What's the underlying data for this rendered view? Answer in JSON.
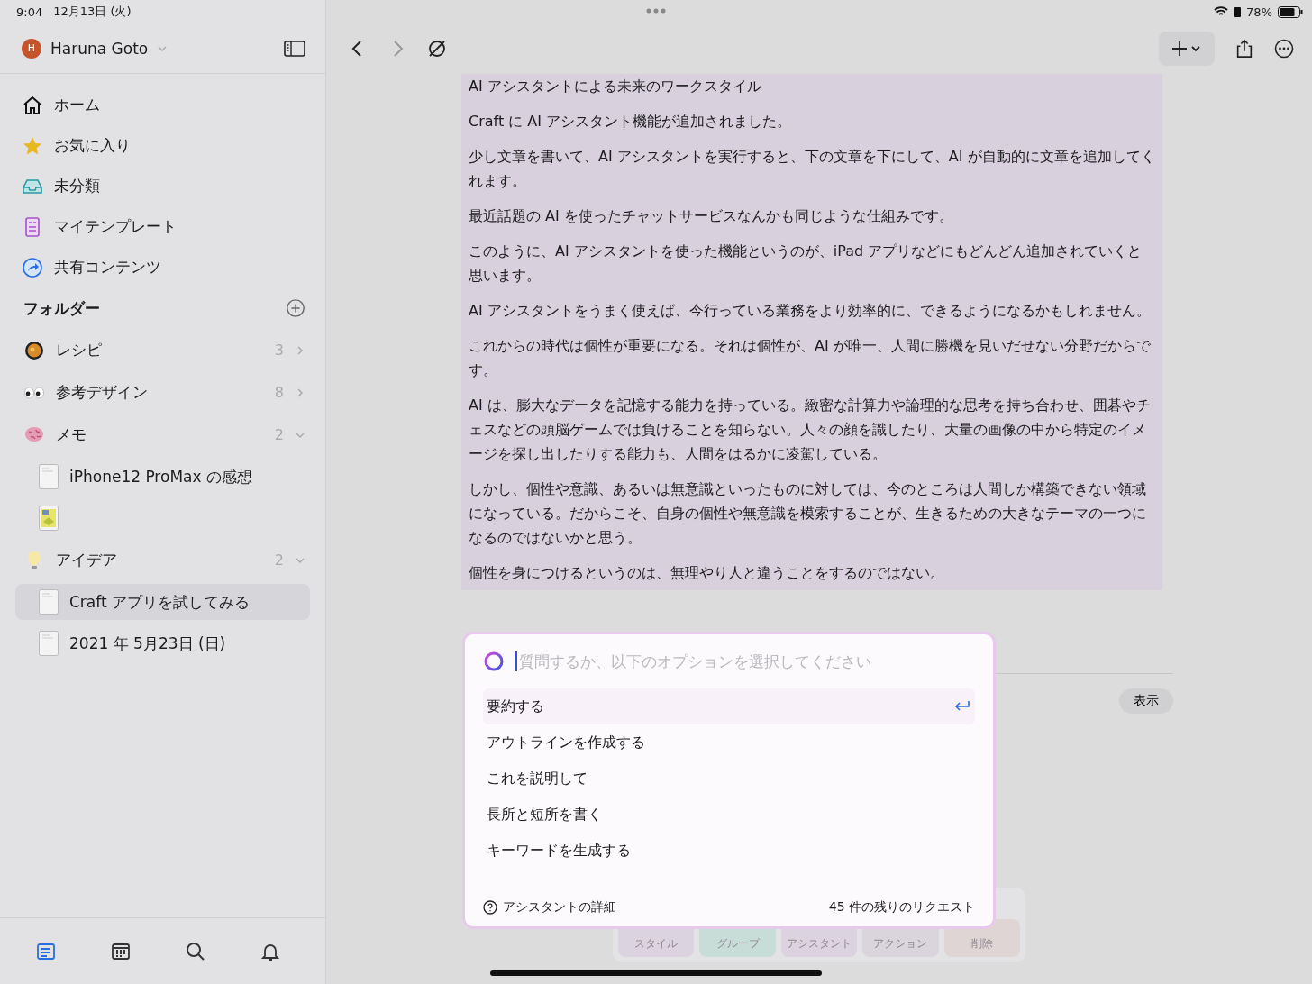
{
  "status_bar": {
    "time": "9:04",
    "date": "12月13日 (火)",
    "battery": "78%"
  },
  "account": {
    "initial": "H",
    "name": "Haruna Goto"
  },
  "nav": [
    {
      "kind": "home",
      "label": "ホーム"
    },
    {
      "kind": "favorites",
      "label": "お気に入り"
    },
    {
      "kind": "inbox",
      "label": "未分類"
    },
    {
      "kind": "templates",
      "label": "マイテンプレート"
    },
    {
      "kind": "shared",
      "label": "共有コンテンツ"
    }
  ],
  "folders_title": "フォルダー",
  "folders": [
    {
      "kind": "recipe",
      "label": "レシピ",
      "count": "3",
      "expanded": false
    },
    {
      "kind": "eyes",
      "label": "参考デザイン",
      "count": "8",
      "expanded": false
    },
    {
      "kind": "brain",
      "label": "メモ",
      "count": "2",
      "expanded": true,
      "children": [
        {
          "kind": "document",
          "title": "iPhone12 ProMax の感想",
          "selected": false
        },
        {
          "kind": "picture",
          "selected": false
        }
      ]
    },
    {
      "kind": "bulb",
      "label": "アイデア",
      "count": "2",
      "expanded": true,
      "children": [
        {
          "kind": "document",
          "title": "Craft アプリを試してみる",
          "selected": true
        },
        {
          "kind": "document",
          "title": "2021 年 5月23日 (日)",
          "selected": false
        }
      ]
    }
  ],
  "bottom_tabs": [
    {
      "kind": "documents",
      "selected": true
    },
    {
      "kind": "calendar",
      "selected": false
    },
    {
      "kind": "search",
      "selected": false
    },
    {
      "kind": "notifications",
      "selected": false
    }
  ],
  "document": {
    "paragraphs": [
      "AI アシスタントによる未来のワークスタイル",
      "Craft に AI アシスタント機能が追加されました。",
      "少し文章を書いて、AI アシスタントを実行すると、下の文章を下にして、AI が自動的に文章を追加してくれます。",
      "最近話題の AI を使ったチャットサービスなんかも同じような仕組みです。",
      "このように、AI アシスタントを使った機能というのが、iPad アプリなどにもどんどん追加されていくと思います。",
      "AI アシスタントをうまく使えば、今行っている業務をより効率的に、できるようになるかもしれません。",
      "これからの時代は個性が重要になる。それは個性が、AI が唯一、人間に勝機を見いだせない分野だからです。",
      "AI は、膨大なデータを記憶する能力を持っている。緻密な計算力や論理的な思考を持ち合わせ、囲碁やチェスなどの頭脳ゲームでは負けることを知らない。人々の顔を識したり、大量の画像の中から特定のイメージを探し出したりする能力も、人間をはるかに凌駕している。",
      "しかし、個性や意識、あるいは無意識といったものに対しては、今のところは人間しか構築できない領域になっている。だからこそ、自身の個性や無意識を模索することが、生きるための大きなテーマの一つになるのではないかと思う。",
      "個性を身につけるというのは、無理やり人と違うことをするのではない。"
    ],
    "show_button": "表示"
  },
  "assistant": {
    "placeholder": "質問するか、以下のオプションを選択してください",
    "options": [
      {
        "label": "要約する",
        "selected": true
      },
      {
        "label": "アウトラインを作成する",
        "selected": false
      },
      {
        "label": "これを説明して",
        "selected": false
      },
      {
        "label": "長所と短所を書く",
        "selected": false
      },
      {
        "label": "キーワードを生成する",
        "selected": false
      }
    ],
    "details": "アシスタントの詳細",
    "remaining": "45 件の残りのリクエスト"
  },
  "block_toolbar": [
    {
      "label": "スタイル",
      "color": "#dcd3e0"
    },
    {
      "label": "グループ",
      "color": "#c9ddd8"
    },
    {
      "label": "アシスタント",
      "color": "#dcd3e0"
    },
    {
      "label": "アクション",
      "color": "#dad5dc"
    },
    {
      "label": "削除",
      "color": "#e0d5d5"
    }
  ]
}
